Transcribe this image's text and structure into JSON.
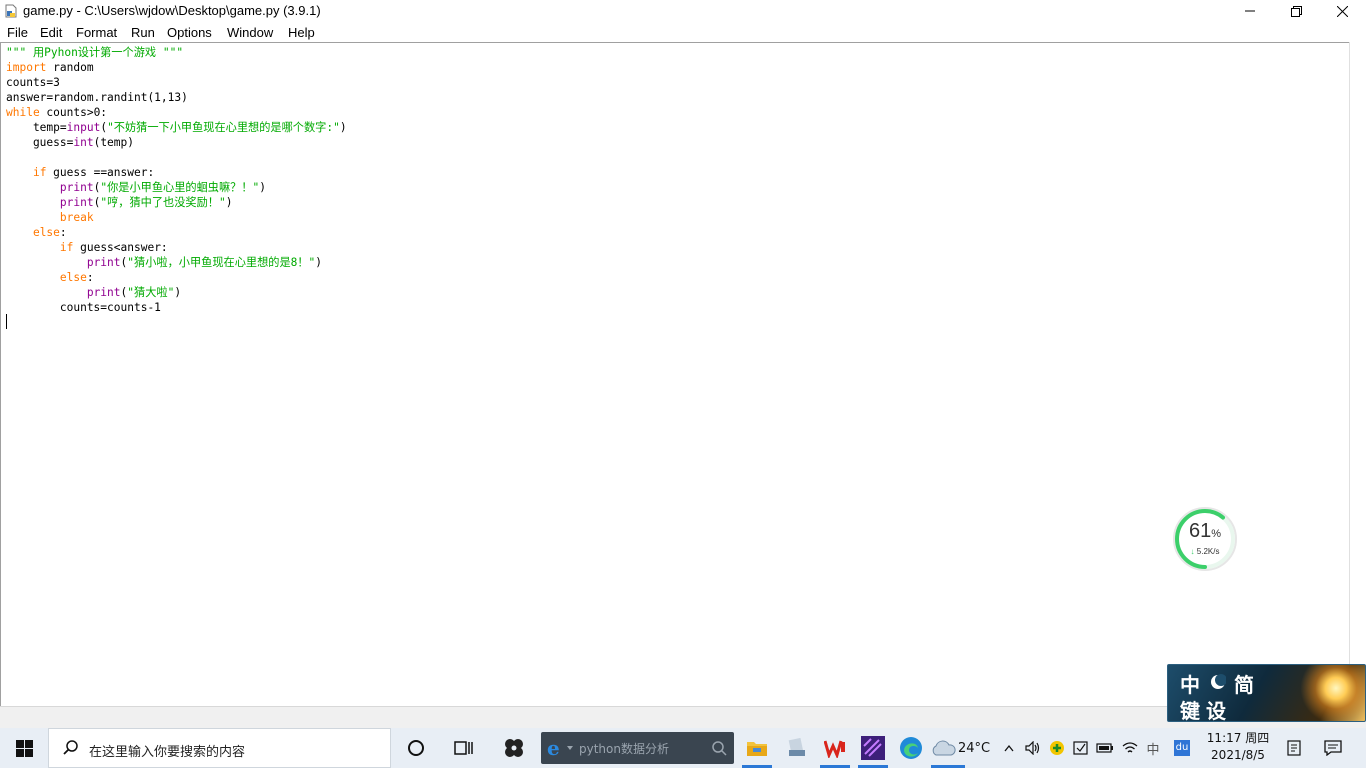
{
  "window": {
    "title": "game.py - C:\\Users\\wjdow\\Desktop\\game.py (3.9.1)"
  },
  "menu": [
    "File",
    "Edit",
    "Format",
    "Run",
    "Options",
    "Window",
    "Help"
  ],
  "code_lines": [
    "\"\"\" 用Pyhon设计第一个游戏 \"\"\"",
    "import random",
    "counts=3",
    "answer=random.randint(1,13)",
    "while counts>0:",
    "    temp=input(\"不妨猜一下小甲鱼现在心里想的是哪个数字:\")",
    "    guess=int(temp)",
    "",
    "    if guess ==answer:",
    "        print(\"你是小甲鱼心里的蛔虫嘛？！\")",
    "        print(\"哼，猜中了也没奖励！\")",
    "        break",
    "    else:",
    "        if guess<answer:",
    "            print(\"猜小啦，小甲鱼现在心里想的是8！\")",
    "        else:",
    "            print(\"猜大啦\")",
    "        counts=counts-1"
  ],
  "gauge": {
    "percent": "61",
    "percent_unit": "%",
    "speed": "5.2K/s",
    "fill_fraction": 0.61
  },
  "ime": {
    "chars": [
      "中",
      "简",
      "键",
      "设"
    ]
  },
  "taskbar": {
    "search_placeholder": "在这里输入你要搜索的内容",
    "ie_search_text": "python数据分析",
    "weather": "24°C",
    "tray_ime": "中",
    "tray_du": "du",
    "time": "11:17 周四",
    "date": "2021/8/5"
  },
  "colors": {
    "keyword": "#ff7700",
    "string": "#00aa00",
    "builtin": "#900090",
    "taskbar_bg": "#e8eef5",
    "gauge_green": "#3ccf6a"
  }
}
